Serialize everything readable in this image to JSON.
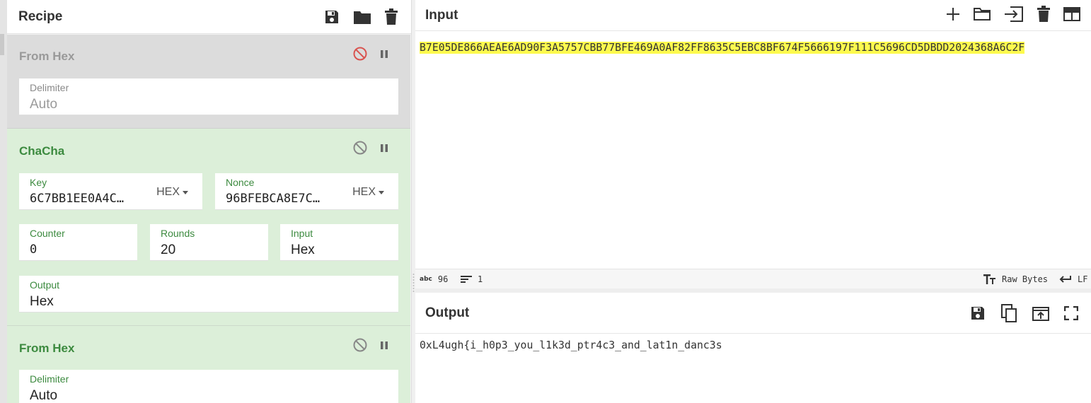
{
  "recipe": {
    "title": "Recipe",
    "icons": [
      "save-icon",
      "folder-icon",
      "trash-icon"
    ],
    "ops": [
      {
        "name": "From Hex",
        "state": "disabled",
        "delimiter_label": "Delimiter",
        "delimiter_value": "Auto"
      },
      {
        "name": "ChaCha",
        "state": "active",
        "key_label": "Key",
        "key_value": "6C7BB1EE0A4C…",
        "key_format": "HEX",
        "nonce_label": "Nonce",
        "nonce_value": "96BFEBCA8E7C…",
        "nonce_format": "HEX",
        "counter_label": "Counter",
        "counter_value": "0",
        "rounds_label": "Rounds",
        "rounds_value": "20",
        "input_label": "Input",
        "input_value": "Hex",
        "output_label": "Output",
        "output_value": "Hex"
      },
      {
        "name": "From Hex",
        "state": "active",
        "delimiter_label": "Delimiter",
        "delimiter_value": "Auto"
      }
    ]
  },
  "input": {
    "title": "Input",
    "icons": [
      "plus-icon",
      "folder-icon",
      "import-icon",
      "trash-icon",
      "layout-icon"
    ],
    "text": "B7E05DE866AEAE6AD90F3A5757CBB77BFE469A0AF82FF8635C5EBC8BF674F5666197F111C5696CD5DBDD2024368A6C2F",
    "status": {
      "chars_icon": "abc",
      "chars": "96",
      "lines": "1",
      "raw_bytes": "Raw Bytes",
      "eol": "LF"
    }
  },
  "output": {
    "title": "Output",
    "icons": [
      "save-icon",
      "copy-icon",
      "replace-input-icon",
      "fullscreen-icon"
    ],
    "text": "0xL4ugh{i_h0p3_you_l1k3d_ptr4c3_and_lat1n_danc3s"
  },
  "colors": {
    "active_op_bg": "#dcefd9",
    "disabled_op_bg": "#dcdcdc",
    "active_label": "#3c8a3f",
    "disable_icon_red": "#d9534f",
    "highlight": "#fdfa4e"
  }
}
